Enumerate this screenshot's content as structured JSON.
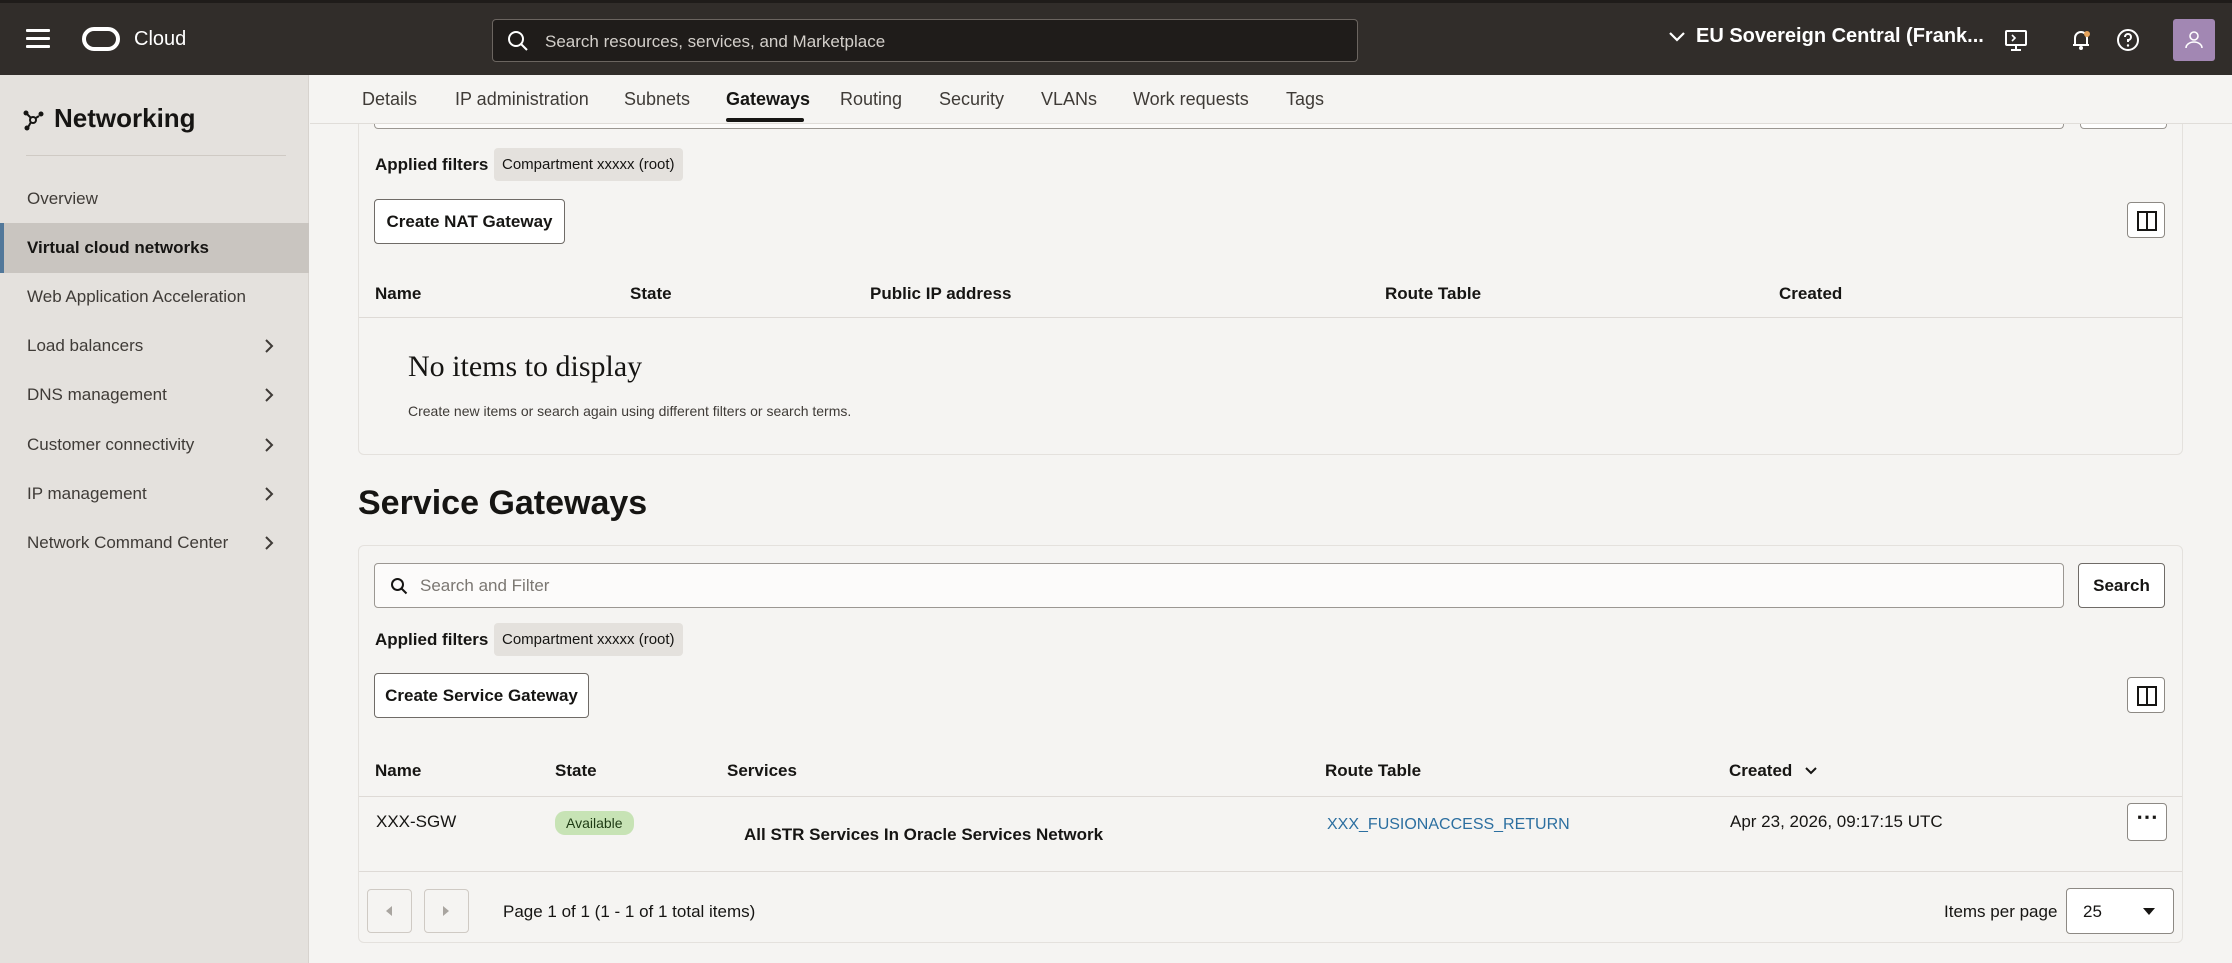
{
  "header": {
    "brand": "Cloud",
    "search_placeholder": "Search resources, services, and Marketplace",
    "region": "EU Sovereign Central (Frank..."
  },
  "sidebar": {
    "title": "Networking",
    "items": [
      {
        "label": "Overview"
      },
      {
        "label": "Virtual cloud networks"
      },
      {
        "label": "Web Application Acceleration"
      },
      {
        "label": "Load balancers"
      },
      {
        "label": "DNS management"
      },
      {
        "label": "Customer connectivity"
      },
      {
        "label": "IP management"
      },
      {
        "label": "Network Command Center"
      }
    ]
  },
  "tabs": [
    {
      "label": "Details"
    },
    {
      "label": "IP administration"
    },
    {
      "label": "Subnets"
    },
    {
      "label": "Gateways"
    },
    {
      "label": "Routing"
    },
    {
      "label": "Security"
    },
    {
      "label": "VLANs"
    },
    {
      "label": "Work requests"
    },
    {
      "label": "Tags"
    }
  ],
  "nat": {
    "applied_filters_label": "Applied filters",
    "filter_chip": "Compartment xxxxx (root)",
    "create_button": "Create NAT Gateway",
    "columns": [
      "Name",
      "State",
      "Public IP address",
      "Route Table",
      "Created"
    ],
    "empty_title": "No items to display",
    "empty_desc": "Create new items or search again using different filters or search terms."
  },
  "sgw": {
    "title": "Service Gateways",
    "search_placeholder": "Search and Filter",
    "search_button": "Search",
    "applied_filters_label": "Applied filters",
    "filter_chip": "Compartment xxxxx (root)",
    "create_button": "Create Service Gateway",
    "columns": [
      "Name",
      "State",
      "Services",
      "Route Table",
      "Created"
    ],
    "rows": [
      {
        "name": "XXX-SGW",
        "state": "Available",
        "services": "All STR Services In Oracle Services Network",
        "route_table": "XXX_FUSIONACCESS_RETURN",
        "created": "Apr 23, 2026, 09:17:15 UTC"
      }
    ],
    "pagination": "Page 1 of 1 (1 - 1 of 1 total items)",
    "items_per_page_label": "Items per page",
    "items_per_page": "25"
  }
}
